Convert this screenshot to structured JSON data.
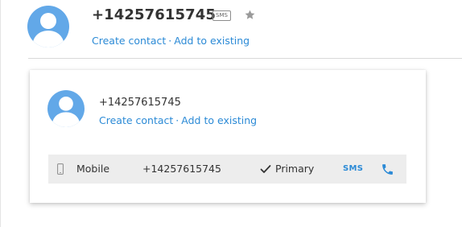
{
  "header": {
    "phone_number": "+14257615745",
    "badge": "SMS",
    "star_icon": "star-icon",
    "create_contact": "Create contact",
    "separator": "·",
    "add_to_existing": "Add to existing"
  },
  "card": {
    "phone_number": "+14257615745",
    "create_contact": "Create contact",
    "separator": "·",
    "add_to_existing": "Add to existing",
    "row": {
      "device_icon": "mobile-phone-icon",
      "type": "Mobile",
      "number": "+14257615745",
      "check_icon": "checkmark-icon",
      "primary": "Primary",
      "sms": "SMS",
      "call_icon": "phone-call-icon"
    }
  },
  "colors": {
    "link": "#2b8ad6",
    "avatar": "#62a8e8",
    "row_background": "#ededed"
  }
}
